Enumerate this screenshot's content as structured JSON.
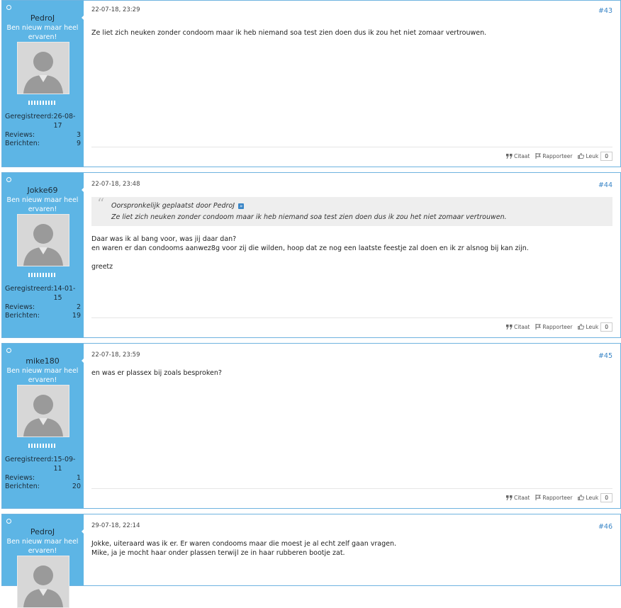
{
  "posts": [
    {
      "username": "PedroJ",
      "user_title": "Ben nieuw maar heel ervaren!",
      "stats": {
        "registered_label": "Geregistreerd:",
        "registered": "26-08-17",
        "reviews_label": "Reviews:",
        "reviews": "3",
        "messages_label": "Berichten:",
        "messages": "9"
      },
      "date": "22-07-18, 23:29",
      "number": "#43",
      "lines": [
        "Ze liet zich neuken zonder condoom maar ik heb niemand soa test zien doen dus ik zou het niet zomaar vertrouwen."
      ],
      "actions": {
        "quote": "Citaat",
        "report": "Rapporteer",
        "like": "Leuk",
        "likes": "0"
      }
    },
    {
      "username": "Jokke69",
      "user_title": "Ben nieuw maar heel ervaren!",
      "stats": {
        "registered_label": "Geregistreerd:",
        "registered": "14-01-15",
        "reviews_label": "Reviews:",
        "reviews": "2",
        "messages_label": "Berichten:",
        "messages": "19"
      },
      "date": "22-07-18, 23:48",
      "number": "#44",
      "quote": {
        "header": "Oorspronkelijk geplaatst door PedroJ",
        "text": "Ze liet zich neuken zonder condoom maar ik heb niemand soa test zien doen dus ik zou het niet zomaar vertrouwen."
      },
      "lines": [
        "Daar was ik al bang voor, was jij daar dan?",
        "en waren er dan condooms aanwez8g voor zij die wilden, hoop dat ze nog een laatste feestje zal doen en ik zr alsnog bij kan zijn.",
        "",
        "greetz"
      ],
      "actions": {
        "quote": "Citaat",
        "report": "Rapporteer",
        "like": "Leuk",
        "likes": "0"
      }
    },
    {
      "username": "mike180",
      "user_title": "Ben nieuw maar heel ervaren!",
      "stats": {
        "registered_label": "Geregistreerd:",
        "registered": "15-09-11",
        "reviews_label": "Reviews:",
        "reviews": "1",
        "messages_label": "Berichten:",
        "messages": "20"
      },
      "date": "22-07-18, 23:59",
      "number": "#45",
      "lines": [
        "en was er plassex bij zoals besproken?"
      ],
      "actions": {
        "quote": "Citaat",
        "report": "Rapporteer",
        "like": "Leuk",
        "likes": "0"
      }
    },
    {
      "username": "PedroJ",
      "user_title": "Ben nieuw maar heel ervaren!",
      "date": "29-07-18, 22:14",
      "number": "#46",
      "lines": [
        "Jokke, uiteraard was ik er. Er waren condooms maar die moest je al echt zelf gaan vragen.",
        "Mike, ja je mocht haar onder plassen terwijl ze in haar rubberen bootje zat."
      ]
    }
  ]
}
